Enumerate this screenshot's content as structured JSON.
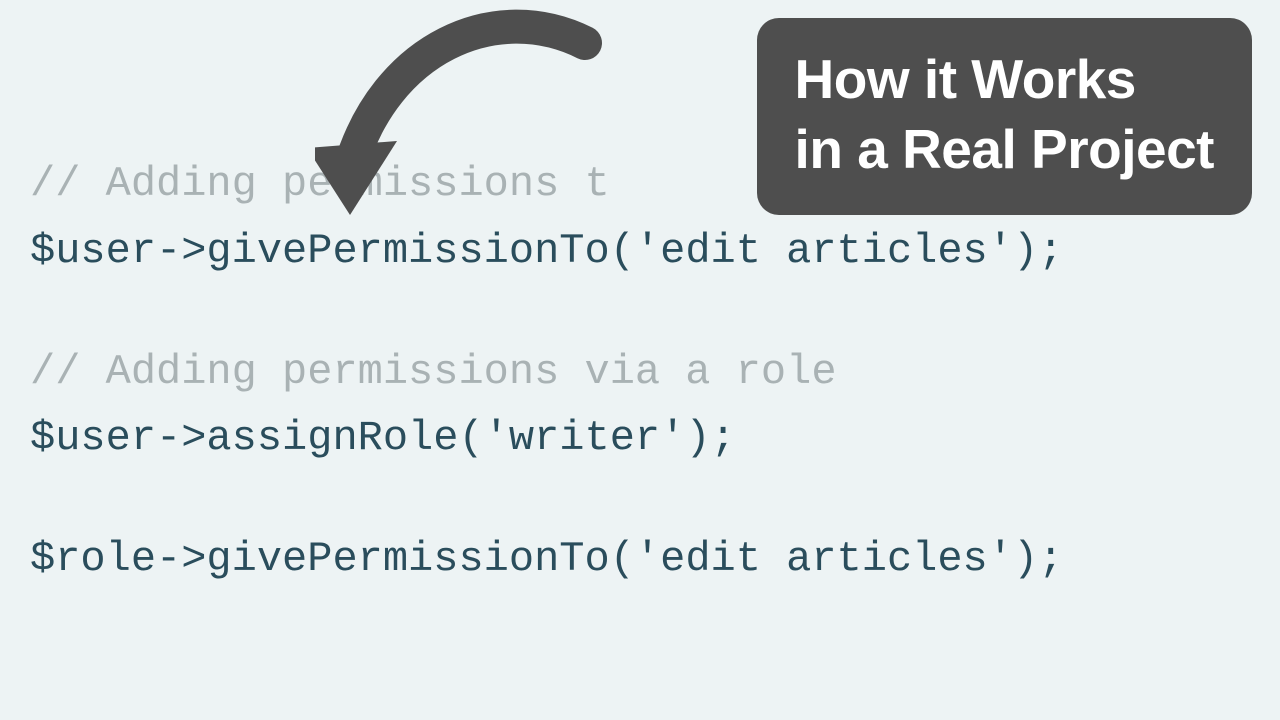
{
  "callout": {
    "line1": "How it Works",
    "line2": "in a Real Project"
  },
  "code": {
    "comment1": "// Adding permissions t",
    "line1_a": "$user->givePermissionTo(",
    "line1_str": "'edit articles'",
    "line1_b": ");",
    "comment2": "// Adding permissions via a role",
    "line2_a": "$user->assignRole(",
    "line2_str": "'writer'",
    "line2_b": ");",
    "line3_a": "$role->givePermissionTo(",
    "line3_str": "'edit articles'",
    "line3_b": ");"
  }
}
